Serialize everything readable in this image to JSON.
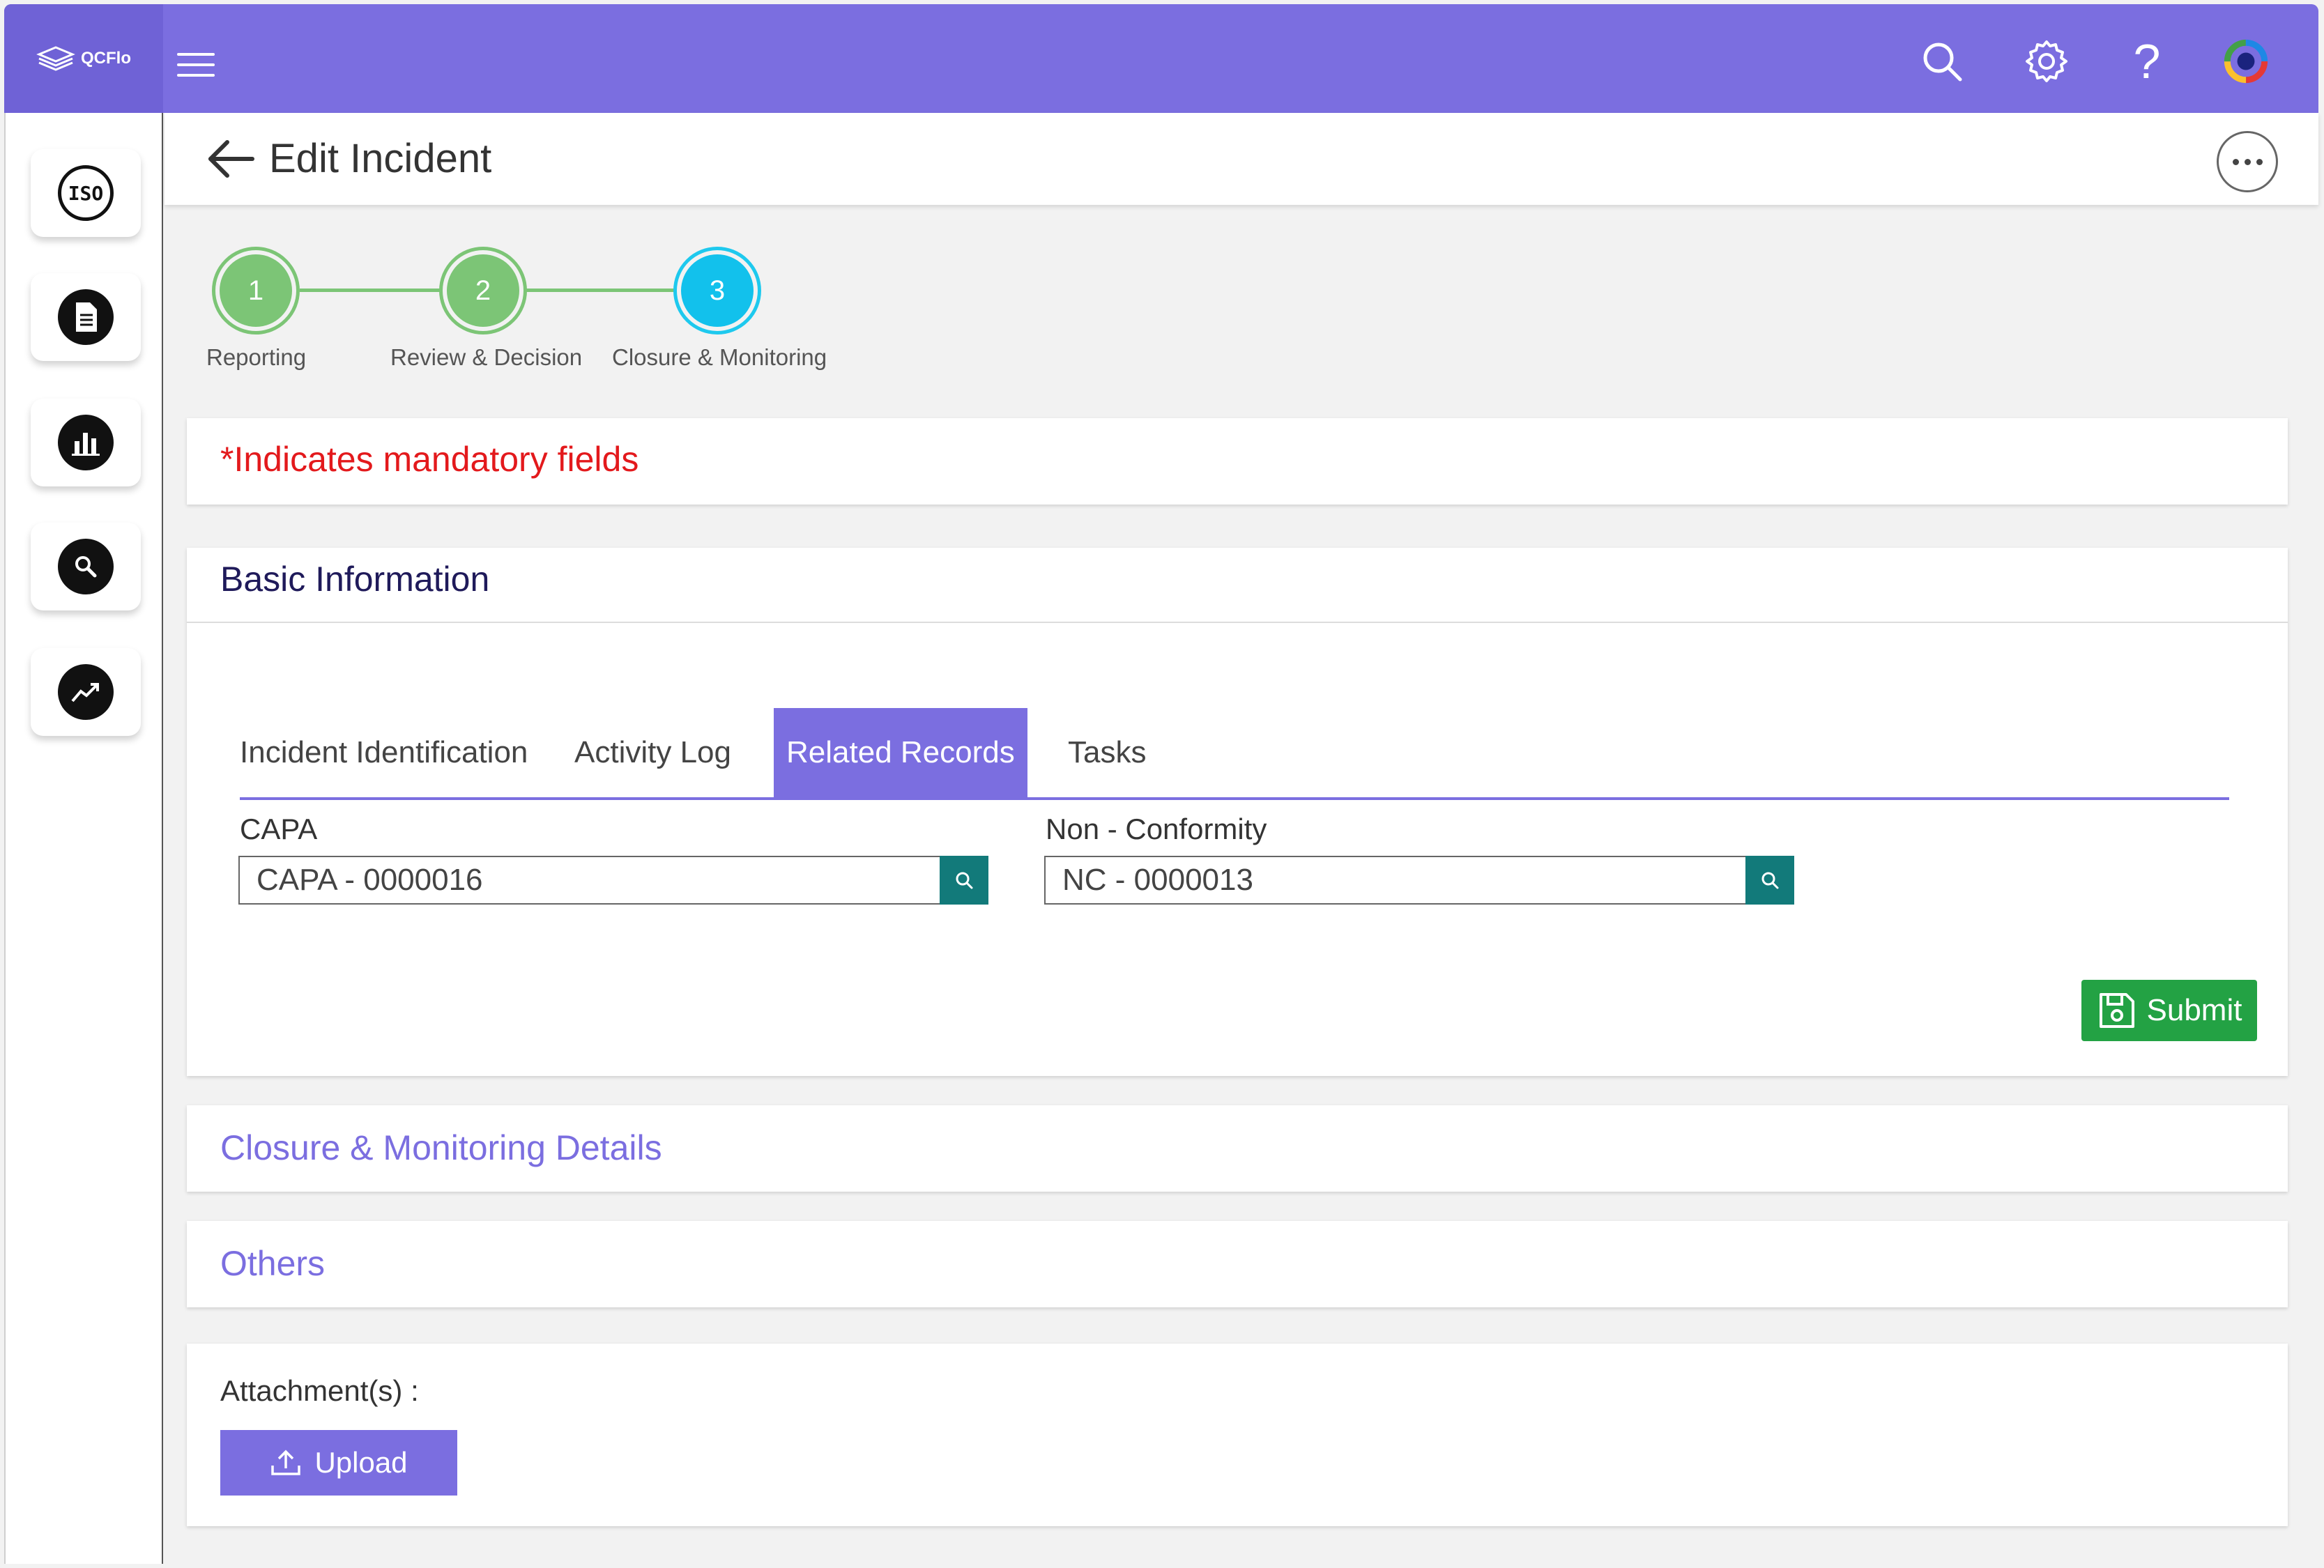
{
  "app": {
    "logo_text": "QCFlo"
  },
  "header": {
    "title": "Edit Incident"
  },
  "stepper": [
    {
      "number": "1",
      "label": "Reporting",
      "state": "complete"
    },
    {
      "number": "2",
      "label": "Review & Decision",
      "state": "complete"
    },
    {
      "number": "3",
      "label": "Closure & Monitoring",
      "state": "active"
    }
  ],
  "mandatory_note": "*Indicates mandatory fields",
  "basic_info": {
    "title": "Basic Information",
    "tabs": [
      {
        "label": "Incident Identification",
        "active": false
      },
      {
        "label": "Activity Log",
        "active": false
      },
      {
        "label": "Related Records",
        "active": true
      },
      {
        "label": "Tasks",
        "active": false
      }
    ],
    "fields": {
      "capa": {
        "label": "CAPA",
        "value": "CAPA - 0000016"
      },
      "nc": {
        "label": "Non - Conformity",
        "value": "NC - 0000013"
      }
    },
    "submit_label": "Submit"
  },
  "sections": {
    "closure": "Closure & Monitoring Details",
    "others": "Others"
  },
  "attachments": {
    "label": "Attachment(s) :",
    "upload_label": "Upload"
  },
  "sidebar_icons": [
    "iso-icon",
    "document-icon",
    "chart-icon",
    "search-icon",
    "trend-icon"
  ],
  "colors": {
    "primary": "#7b6ee0",
    "step_complete": "#7cc576",
    "step_active": "#12c1ec",
    "mandatory_red": "#e3191c",
    "section_link": "#7b6ee0",
    "section_dark": "#1f1a5a",
    "submit_green": "#23a244",
    "search_teal": "#127a7a"
  }
}
